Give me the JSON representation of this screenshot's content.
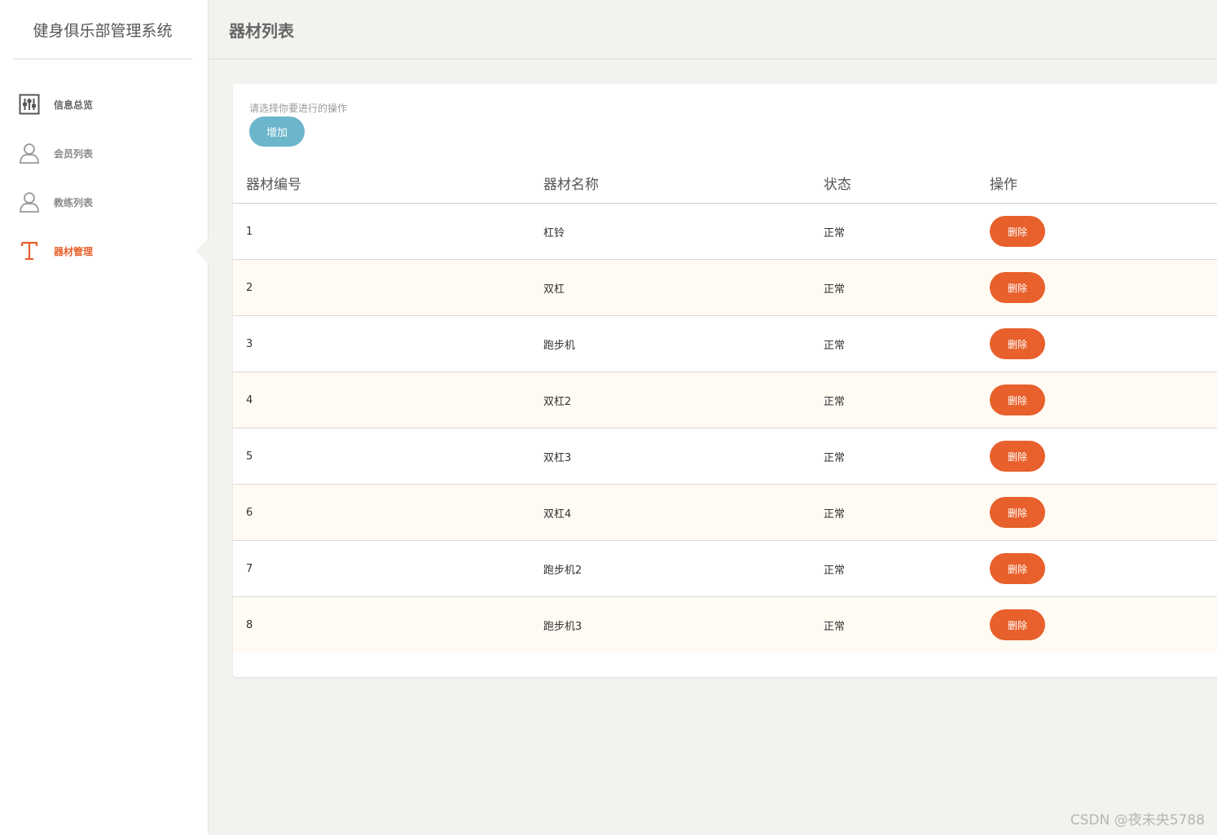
{
  "sidebar": {
    "brand": "健身俱乐部管理系统",
    "items": [
      {
        "label": "信息总览",
        "icon": "sliders-icon"
      },
      {
        "label": "会员列表",
        "icon": "user-icon"
      },
      {
        "label": "教练列表",
        "icon": "user-icon"
      },
      {
        "label": "器材管理",
        "icon": "text-t-icon",
        "active": true
      }
    ]
  },
  "header": {
    "title": "器材列表"
  },
  "toolbar": {
    "hint": "请选择你要进行的操作",
    "add_label": "增加"
  },
  "table": {
    "columns": [
      "器材编号",
      "器材名称",
      "状态",
      "操作"
    ],
    "rows": [
      {
        "id": "1",
        "name": "杠铃",
        "status": "正常",
        "action": "删除"
      },
      {
        "id": "2",
        "name": "双杠",
        "status": "正常",
        "action": "删除"
      },
      {
        "id": "3",
        "name": "跑步机",
        "status": "正常",
        "action": "删除"
      },
      {
        "id": "4",
        "name": "双杠2",
        "status": "正常",
        "action": "删除"
      },
      {
        "id": "5",
        "name": "双杠3",
        "status": "正常",
        "action": "删除"
      },
      {
        "id": "6",
        "name": "双杠4",
        "status": "正常",
        "action": "删除"
      },
      {
        "id": "7",
        "name": "跑步机2",
        "status": "正常",
        "action": "删除"
      },
      {
        "id": "8",
        "name": "跑步机3",
        "status": "正常",
        "action": "删除"
      }
    ]
  },
  "watermark": "CSDN @夜未央5788",
  "colors": {
    "accent": "#e8602b",
    "add_button": "#6cb6cc",
    "background": "#f3f2ef"
  }
}
